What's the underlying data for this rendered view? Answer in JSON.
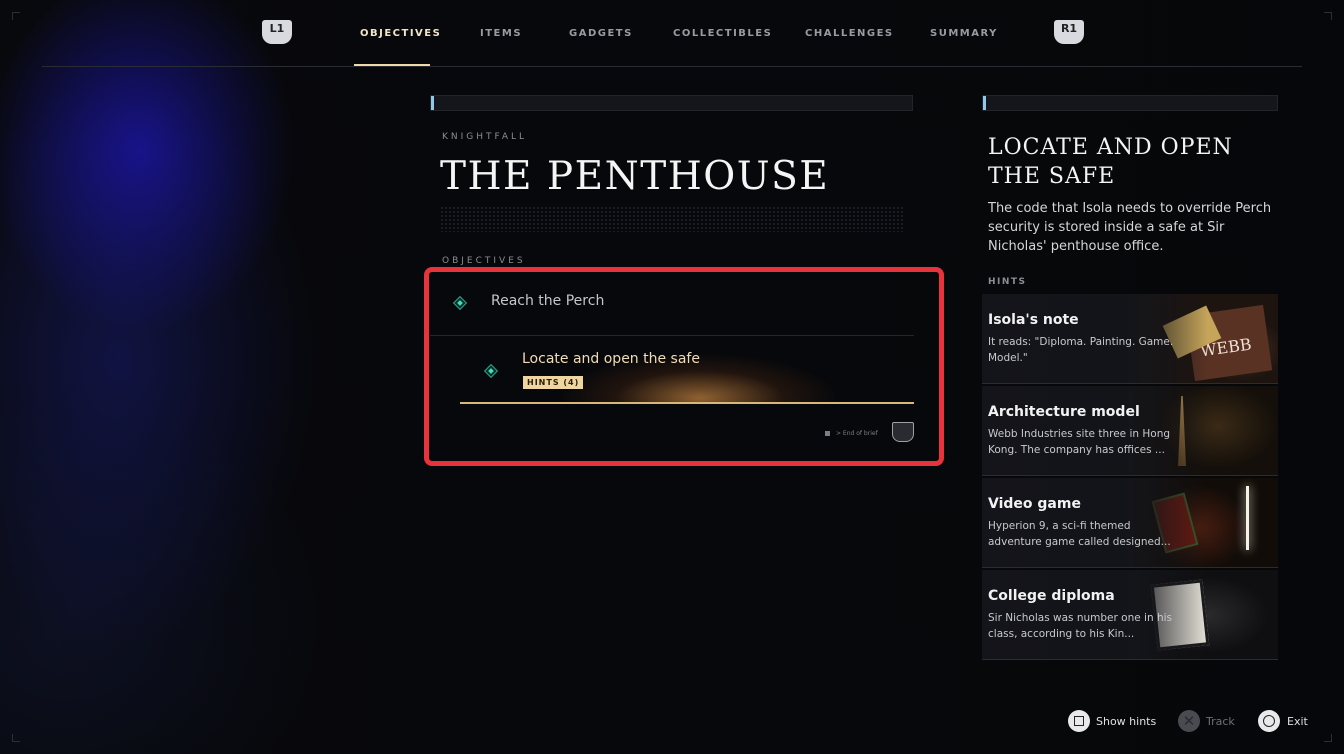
{
  "nav": {
    "left_bumper": "L1",
    "right_bumper": "R1",
    "tabs": [
      "OBJECTIVES",
      "ITEMS",
      "GADGETS",
      "COLLECTIBLES",
      "CHALLENGES",
      "SUMMARY"
    ],
    "active_tab": "OBJECTIVES"
  },
  "mission": {
    "eyebrow": "KNIGHTFALL",
    "title": "THE PENTHOUSE",
    "objectives_label": "OBJECTIVES",
    "objectives": [
      {
        "text": "Reach the Perch",
        "state": "complete"
      },
      {
        "text": "Locate and open the safe",
        "state": "active",
        "hints_badge": "HINTS (4)"
      }
    ],
    "end_of_brief": "> End of brief"
  },
  "detail": {
    "title": "LOCATE AND OPEN THE SAFE",
    "description": "The code that Isola needs to override Perch security is stored inside a safe at Sir Nicholas' penthouse office.",
    "hints_label": "HINTS",
    "hints": [
      {
        "title": "Isola's note",
        "body": "It reads: \"Diploma. Painting. Game. Model.\"",
        "image_label": "WEBB"
      },
      {
        "title": "Architecture model",
        "body": "Webb Industries site three in Hong Kong. The company has offices ..."
      },
      {
        "title": "Video game",
        "body": "Hyperion 9, a sci-fi themed adventure game called designed..."
      },
      {
        "title": "College diploma",
        "body": "Sir Nicholas was number one in his class, according to his Kin..."
      }
    ]
  },
  "footer": {
    "show_hints": "Show hints",
    "track": "Track",
    "exit": "Exit"
  },
  "colors": {
    "accent": "#f0d9a8",
    "highlight_border": "#e8333d",
    "objective_marker": "#3fe0bd"
  }
}
